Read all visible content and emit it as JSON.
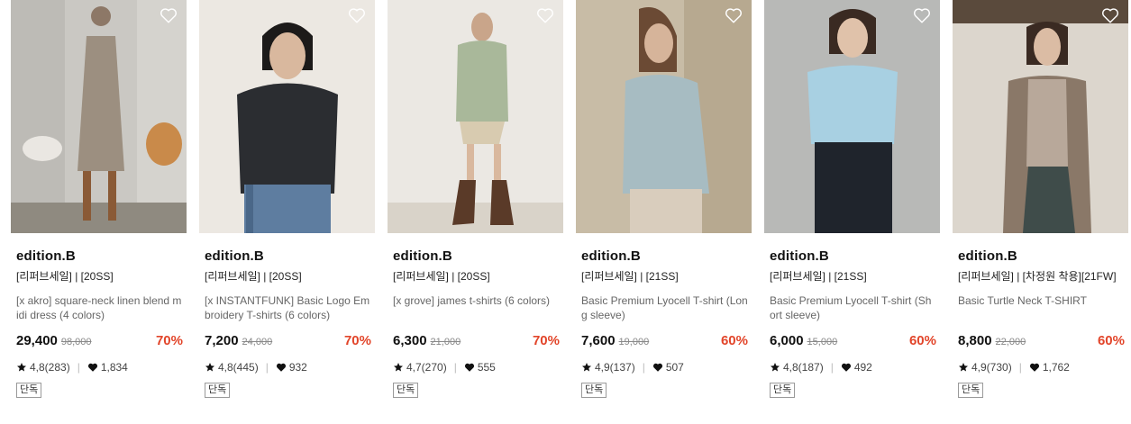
{
  "products": [
    {
      "brand": "edition.B",
      "tags": "[리퍼브세일] | [20SS]",
      "name": "[x akro] square-neck linen blend midi dress (4 colors)",
      "price": "29,400",
      "original_price": "98,000",
      "discount": "70%",
      "rating": "4,8(283)",
      "likes": "1,834",
      "badge": "단독",
      "bg_color": "#c9c7c2",
      "figure_color": "#9c8f80",
      "wish_icon": "heart-outline-icon"
    },
    {
      "brand": "edition.B",
      "tags": "[리퍼브세일] | [20SS]",
      "name": "[x INSTANTFUNK] Basic Logo Embroidery T-shirts (6 colors)",
      "price": "7,200",
      "original_price": "24,000",
      "discount": "70%",
      "rating": "4,8(445)",
      "likes": "932",
      "badge": "단독",
      "bg_color": "#ebe7e1",
      "figure_color": "#2b2d31",
      "wish_icon": "heart-outline-icon"
    },
    {
      "brand": "edition.B",
      "tags": "[리퍼브세일] | [20SS]",
      "name": "[x grove] james t-shirts (6 colors)",
      "price": "6,300",
      "original_price": "21,000",
      "discount": "70%",
      "rating": "4,7(270)",
      "likes": "555",
      "badge": "단독",
      "bg_color": "#e9e6e1",
      "figure_color": "#a9b89a",
      "wish_icon": "heart-outline-icon"
    },
    {
      "brand": "edition.B",
      "tags": "[리퍼브세일] | [21SS]",
      "name": "Basic Premium Lyocell T-shirt (Long sleeve)",
      "price": "7,600",
      "original_price": "19,000",
      "discount": "60%",
      "rating": "4,9(137)",
      "likes": "507",
      "badge": "단독",
      "bg_color": "#c9bda8",
      "figure_color": "#a7bcc2",
      "wish_icon": "heart-outline-icon"
    },
    {
      "brand": "edition.B",
      "tags": "[리퍼브세일] | [21SS]",
      "name": "Basic Premium Lyocell T-shirt (Short sleeve)",
      "price": "6,000",
      "original_price": "15,000",
      "discount": "60%",
      "rating": "4,8(187)",
      "likes": "492",
      "badge": "단독",
      "bg_color": "#b9bab8",
      "figure_color": "#a8d0e2",
      "wish_icon": "heart-outline-icon"
    },
    {
      "brand": "edition.B",
      "tags": "[리퍼브세일] | [차정원 착용][21FW]",
      "name": "Basic Turtle Neck T-SHIRT",
      "price": "8,800",
      "original_price": "22,000",
      "discount": "60%",
      "rating": "4,9(730)",
      "likes": "1,762",
      "badge": "단독",
      "bg_color": "#dcd6cd",
      "figure_color": "#b8a89a",
      "wish_icon": "heart-outline-icon"
    }
  ],
  "icons": {
    "star": "star-icon",
    "like": "heart-filled-icon"
  },
  "colors": {
    "discount": "#e2452a",
    "brand": "#111111",
    "muted": "#888888"
  }
}
